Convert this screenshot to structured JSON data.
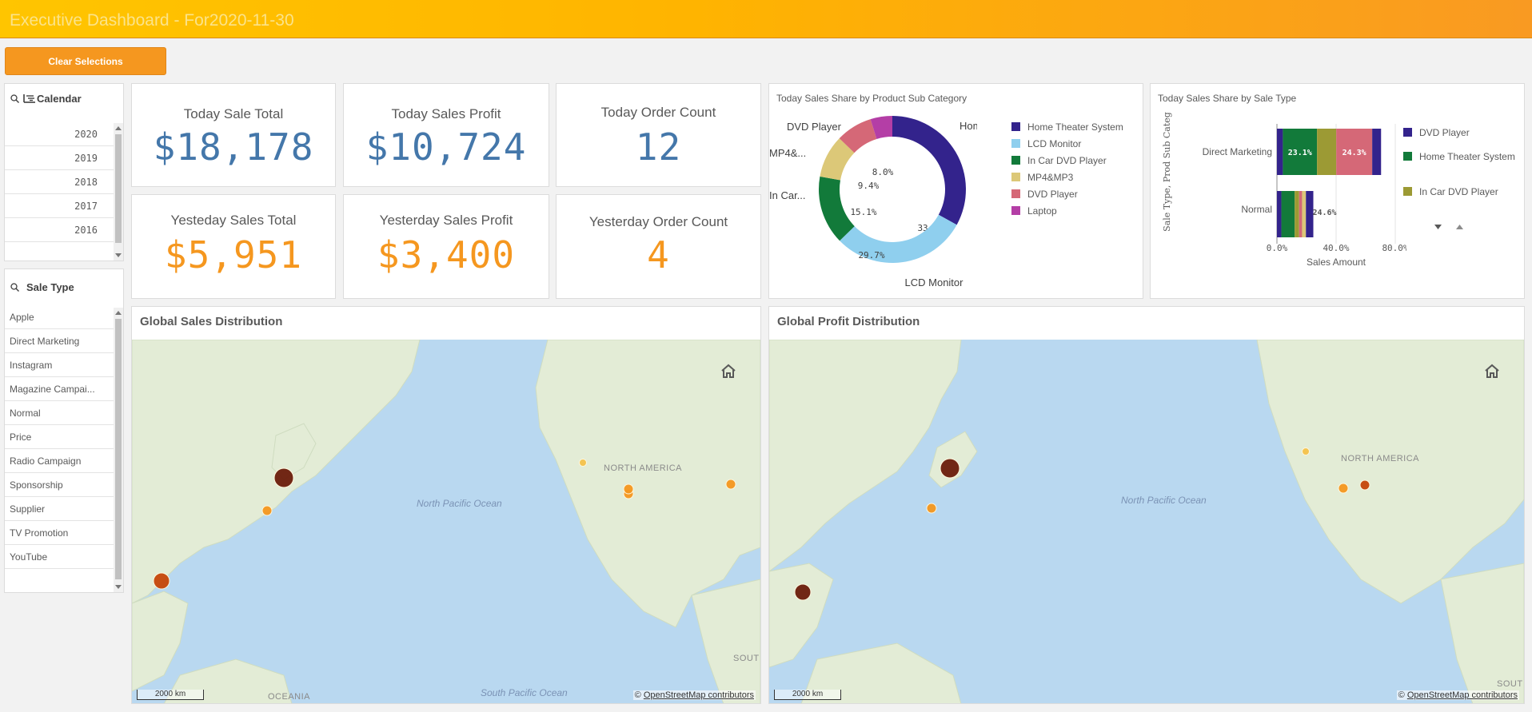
{
  "header": {
    "title": "Executive Dashboard - For2020-11-30"
  },
  "toolbar": {
    "clear_label": "Clear Selections"
  },
  "calendar": {
    "title": "Calendar",
    "years": [
      "2020",
      "2019",
      "2018",
      "2017",
      "2016"
    ]
  },
  "sale_type_filter": {
    "title": "Sale Type",
    "items": [
      "Apple",
      "Direct Marketing",
      "Instagram",
      "Magazine Campai...",
      "Normal",
      "Price",
      "Radio Campaign",
      "Sponsorship",
      "Supplier",
      "TV Promotion",
      "YouTube"
    ]
  },
  "kpis": [
    {
      "title": "Today Sale Total",
      "value": "$18,178"
    },
    {
      "title": "Today Sales Profit",
      "value": "$10,724"
    },
    {
      "title": "Today Order Count",
      "value": "12"
    },
    {
      "title": "Yesteday Sales Total",
      "value": "$5,951"
    },
    {
      "title": "Yesterday Sales Profit",
      "value": "$3,400"
    },
    {
      "title": "Yesterday Order Count",
      "value": "4"
    }
  ],
  "chart_data": [
    {
      "type": "pie",
      "title": "Today Sales Share by Product Sub Category",
      "donut": true,
      "categories": [
        "Home Theater System",
        "LCD Monitor",
        "In Car DVD Player",
        "MP4&MP3",
        "DVD Player",
        "Laptop"
      ],
      "values": [
        33.0,
        29.7,
        15.1,
        9.4,
        8.0,
        4.8
      ],
      "value_labels": [
        "33.0%",
        "29.7%",
        "15.1%",
        "9.4%",
        "8.0%",
        ""
      ],
      "outer_labels": [
        "Home ...",
        "LCD Monitor",
        "In Car...",
        "MP4&...",
        "DVD Player",
        ""
      ],
      "colors": [
        "#33238c",
        "#8fcfee",
        "#127a3a",
        "#dcc878",
        "#d56877",
        "#b43ea6"
      ],
      "legend": "right"
    },
    {
      "type": "bar",
      "orientation": "horizontal",
      "stacked": true,
      "percent": true,
      "title": "Today Sales Share by Sale Type",
      "categories": [
        "Direct Marketing",
        "Normal"
      ],
      "series": [
        {
          "name": "DVD Player",
          "color": "#33238c",
          "values": [
            4.0,
            3.0
          ]
        },
        {
          "name": "Home Theater System",
          "color": "#127a3a",
          "values": [
            23.1,
            9.0
          ]
        },
        {
          "name": "In Car DVD Player",
          "color": "#9c9a34",
          "values": [
            13.0,
            3.0
          ]
        },
        {
          "series_extra": true,
          "color": "#d56877",
          "values": [
            24.3,
            2.0
          ]
        },
        {
          "series_extra": true,
          "color": "#dcc878",
          "values": [
            0,
            2.6
          ]
        },
        {
          "series_extra": true,
          "color": "#33238c",
          "values": [
            6.0,
            5.0
          ]
        }
      ],
      "value_labels": {
        "Direct Marketing": [
          "23.1%",
          "24.3%"
        ],
        "Normal": [
          "24.6%"
        ]
      },
      "xlabel": "Sales Amount",
      "ylabel": "Sale Type, Prod Sub Categ",
      "xticks": [
        "0.0%",
        "40.0%",
        "80.0%"
      ],
      "xlim": [
        0,
        80
      ],
      "legend": "right"
    }
  ],
  "maps": [
    {
      "title": "Global Sales Distribution",
      "labels": {
        "ocean": "North Pacific Ocean",
        "ocean2": "South Pacific Ocean",
        "continent": "NORTH AMERICA",
        "continent2": "OCEANIA",
        "continent3": "SOUT"
      },
      "scale": "2000 km",
      "attribution_prefix": "© ",
      "attribution_link": "OpenStreetMap contributors",
      "markers": [
        {
          "place": "Japan",
          "color": "#6b1d0b",
          "size": "large"
        },
        {
          "place": "South Korea",
          "color": "#f5971f",
          "size": "small"
        },
        {
          "place": "Thailand",
          "color": "#c6460a",
          "size": "medium"
        },
        {
          "place": "Seattle",
          "color": "#f5c24b",
          "size": "tiny"
        },
        {
          "place": "Denver",
          "color": "#f5971f",
          "size": "small"
        },
        {
          "place": "Kansas",
          "color": "#f5971f",
          "size": "small"
        },
        {
          "place": "New York",
          "color": "#f5971f",
          "size": "small"
        }
      ]
    },
    {
      "title": "Global Profit Distribution",
      "labels": {
        "ocean": "North Pacific Ocean",
        "continent": "NORTH AMERICA",
        "continent3": "SOUT"
      },
      "scale": "2000 km",
      "attribution_prefix": "© ",
      "attribution_link": "OpenStreetMap contributors",
      "markers": [
        {
          "place": "Japan",
          "color": "#6b1d0b",
          "size": "large"
        },
        {
          "place": "South Korea",
          "color": "#f5971f",
          "size": "small"
        },
        {
          "place": "Thailand",
          "color": "#6b1d0b",
          "size": "medium"
        },
        {
          "place": "Seattle",
          "color": "#f5c24b",
          "size": "tiny"
        },
        {
          "place": "Denver",
          "color": "#f5971f",
          "size": "small"
        },
        {
          "place": "New York",
          "color": "#c6460a",
          "size": "small"
        }
      ]
    }
  ]
}
